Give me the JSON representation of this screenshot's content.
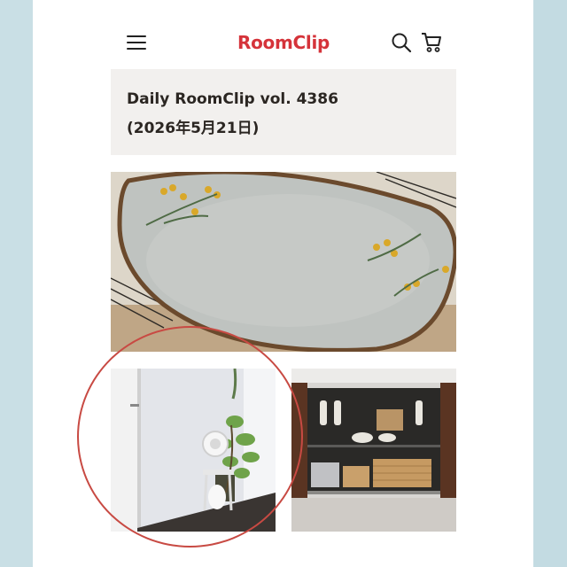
{
  "header": {
    "logo_text": "RoomClip",
    "menu_icon": "hamburger-menu-icon",
    "search_icon": "search-icon",
    "cart_icon": "shopping-cart-icon"
  },
  "article": {
    "title_line1": "Daily RoomClip vol. 4386",
    "title_line2": "(2026年5月21日)"
  },
  "photos": [
    {
      "subject": "mimosa-plate-photo"
    },
    {
      "subject": "room-plant-fan-photo"
    },
    {
      "subject": "kitchen-cabinet-photo"
    }
  ],
  "colors": {
    "brand": "#d5333a",
    "highlight_circle": "#c84a43",
    "title_bg": "#f2f0ee",
    "side_bg": "#c9dfe5"
  }
}
